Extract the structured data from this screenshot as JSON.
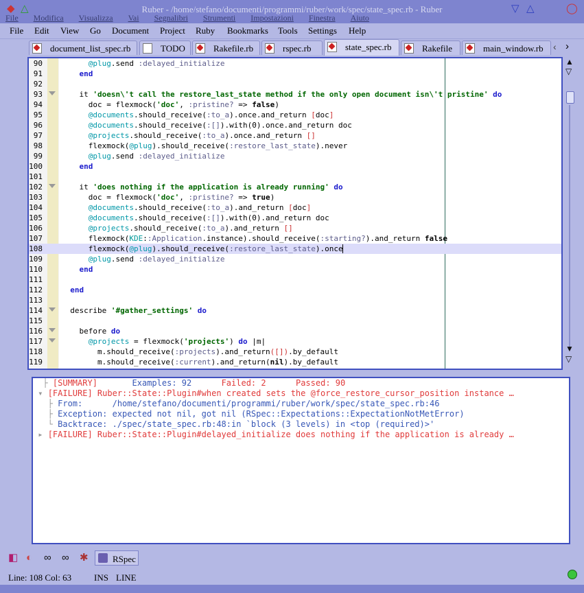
{
  "window": {
    "title": "Ruber - /home/stefano/documenti/programmi/ruber/work/spec/state_spec.rb - Ruber",
    "ghost_menu": [
      "File",
      "Modifica",
      "Visualizza",
      "Vai",
      "Segnalibri",
      "Strumenti",
      "Impostazioni",
      "Finestra",
      "Aiuto"
    ]
  },
  "menubar": [
    "File",
    "Edit",
    "View",
    "Go",
    "Document",
    "Project",
    "Ruby",
    "Bookmarks",
    "Tools",
    "Settings",
    "Help"
  ],
  "tabs": [
    {
      "label": "document_list_spec.rb",
      "active": false
    },
    {
      "label": "TODO",
      "active": false
    },
    {
      "label": "Rakefile.rb",
      "active": false
    },
    {
      "label": "rspec.rb",
      "active": false
    },
    {
      "label": "state_spec.rb",
      "active": true
    },
    {
      "label": "Rakefile",
      "active": false
    },
    {
      "label": "main_window.rb",
      "active": false
    }
  ],
  "editor": {
    "current_line": 108,
    "line_numbers": [
      "90",
      "91",
      "92",
      "93",
      "94",
      "95",
      "96",
      "97",
      "98",
      "99",
      "100",
      "101",
      "102",
      "103",
      "104",
      "105",
      "106",
      "107",
      "108",
      "109",
      "110",
      "111",
      "112",
      "113",
      "114",
      "115",
      "116",
      "117",
      "118",
      "119"
    ],
    "code_lines": [
      "      @plug.send :delayed_initialize",
      "    end",
      "",
      "    it 'doesn\\'t call the restore_last_state method if the only open document isn\\'t pristine' do",
      "      doc = flexmock('doc', :pristine? => false)",
      "      @documents.should_receive(:to_a).once.and_return [doc]",
      "      @documents.should_receive(:[]).with(0).once.and_return doc",
      "      @projects.should_receive(:to_a).once.and_return []",
      "      flexmock(@plug).should_receive(:restore_last_state).never",
      "      @plug.send :delayed_initialize",
      "    end",
      "",
      "    it 'does nothing if the application is already running' do",
      "      doc = flexmock('doc', :pristine? => true)",
      "      @documents.should_receive(:to_a).and_return [doc]",
      "      @documents.should_receive(:[]).with(0).and_return doc",
      "      @projects.should_receive(:to_a).and_return []",
      "      flexmock(KDE::Application.instance).should_receive(:starting?).and_return false",
      "      flexmock(@plug).should_receive(:restore_last_state).once",
      "      @plug.send :delayed_initialize",
      "    end",
      "",
      "  end",
      "",
      "  describe '#gather_settings' do",
      "",
      "    before do",
      "      @projects = flexmock('projects') do |m|",
      "        m.should_receive(:projects).and_return([]).by_default",
      "        m.should_receive(:current).and_return(nil).by_default"
    ],
    "folds": [
      93,
      102,
      114,
      116,
      117
    ]
  },
  "output": {
    "summary_label": "[SUMMARY]",
    "examples": "Examples: 92",
    "failed": "Failed: 2",
    "passed": "Passed: 90",
    "failure1": "[FAILURE] Ruber::State::Plugin#when created sets the @force_restore_cursor_position instance …",
    "from": "From:      /home/stefano/documenti/programmi/ruber/work/spec/state_spec.rb:46",
    "exception": "Exception: expected not nil, got nil (RSpec::Expectations::ExpectationNotMetError)",
    "backtrace": "Backtrace: ./spec/state_spec.rb:48:in `block (3 levels) in <top (required)>'",
    "failure2": "[FAILURE] Ruber::State::Plugin#delayed_initialize does nothing if the application is already …"
  },
  "toolbar": {
    "rspec_label": "RSpec"
  },
  "status": {
    "position": "Line: 108 Col: 63",
    "mode": "INS",
    "selection": "LINE"
  }
}
